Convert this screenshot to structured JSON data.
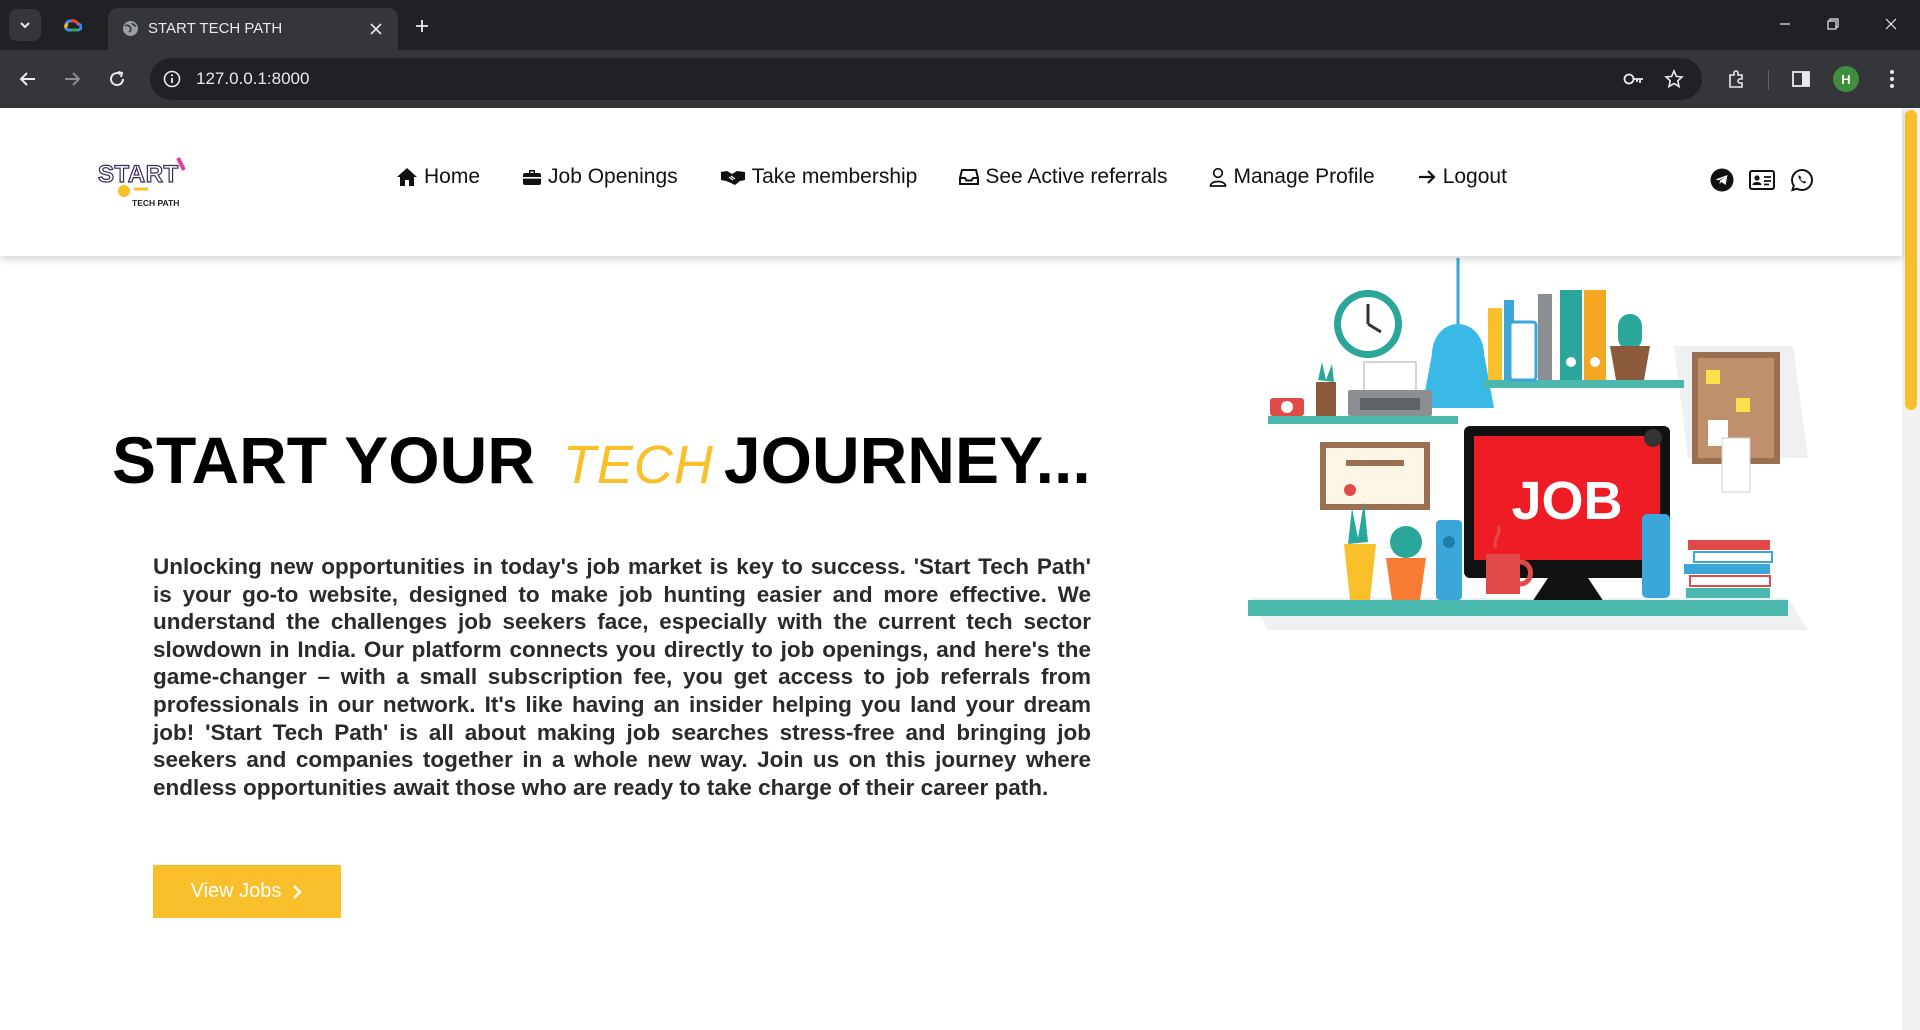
{
  "browser": {
    "tab_title": "START TECH PATH",
    "url": "127.0.0.1:8000",
    "profile_initial": "H"
  },
  "site": {
    "logo_text": "START",
    "logo_sub": "TECH PATH",
    "nav": [
      {
        "label": "Home",
        "icon": "home-icon"
      },
      {
        "label": "Job Openings",
        "icon": "briefcase-icon"
      },
      {
        "label": "Take membership",
        "icon": "handshake-icon"
      },
      {
        "label": "See Active referrals",
        "icon": "inbox-icon"
      },
      {
        "label": "Manage Profile",
        "icon": "user-icon"
      },
      {
        "label": "Logout",
        "icon": "arrow-right-icon"
      }
    ],
    "social": [
      "telegram-icon",
      "contact-card-icon",
      "whatsapp-icon"
    ]
  },
  "hero": {
    "title_start": "START YOUR",
    "title_highlight": "TECH",
    "title_end": "JOURNEY...",
    "description": "Unlocking new opportunities in today's job market is key to success. 'Start Tech Path' is your go-to website, designed to make job hunting easier and more effective. We understand the challenges job seekers face, especially with the current tech sector slowdown in India. Our platform connects you directly to job openings, and here's the game-changer – with a small subscription fee, you get access to job referrals from professionals in our network. It's like having an insider helping you land your dream job! 'Start Tech Path' is all about making job searches stress-free and bringing job seekers and companies together in a whole new way. Join us on this journey where endless opportunities await those who are ready to take charge of their career path.",
    "cta_label": "View Jobs",
    "illustration_text": "JOB"
  },
  "colors": {
    "accent": "#f9c02c",
    "chrome_dark": "#202124",
    "chrome_toolbar": "#35363a",
    "monitor_red": "#ee1c24",
    "shelf_teal": "#4bb8ad"
  }
}
